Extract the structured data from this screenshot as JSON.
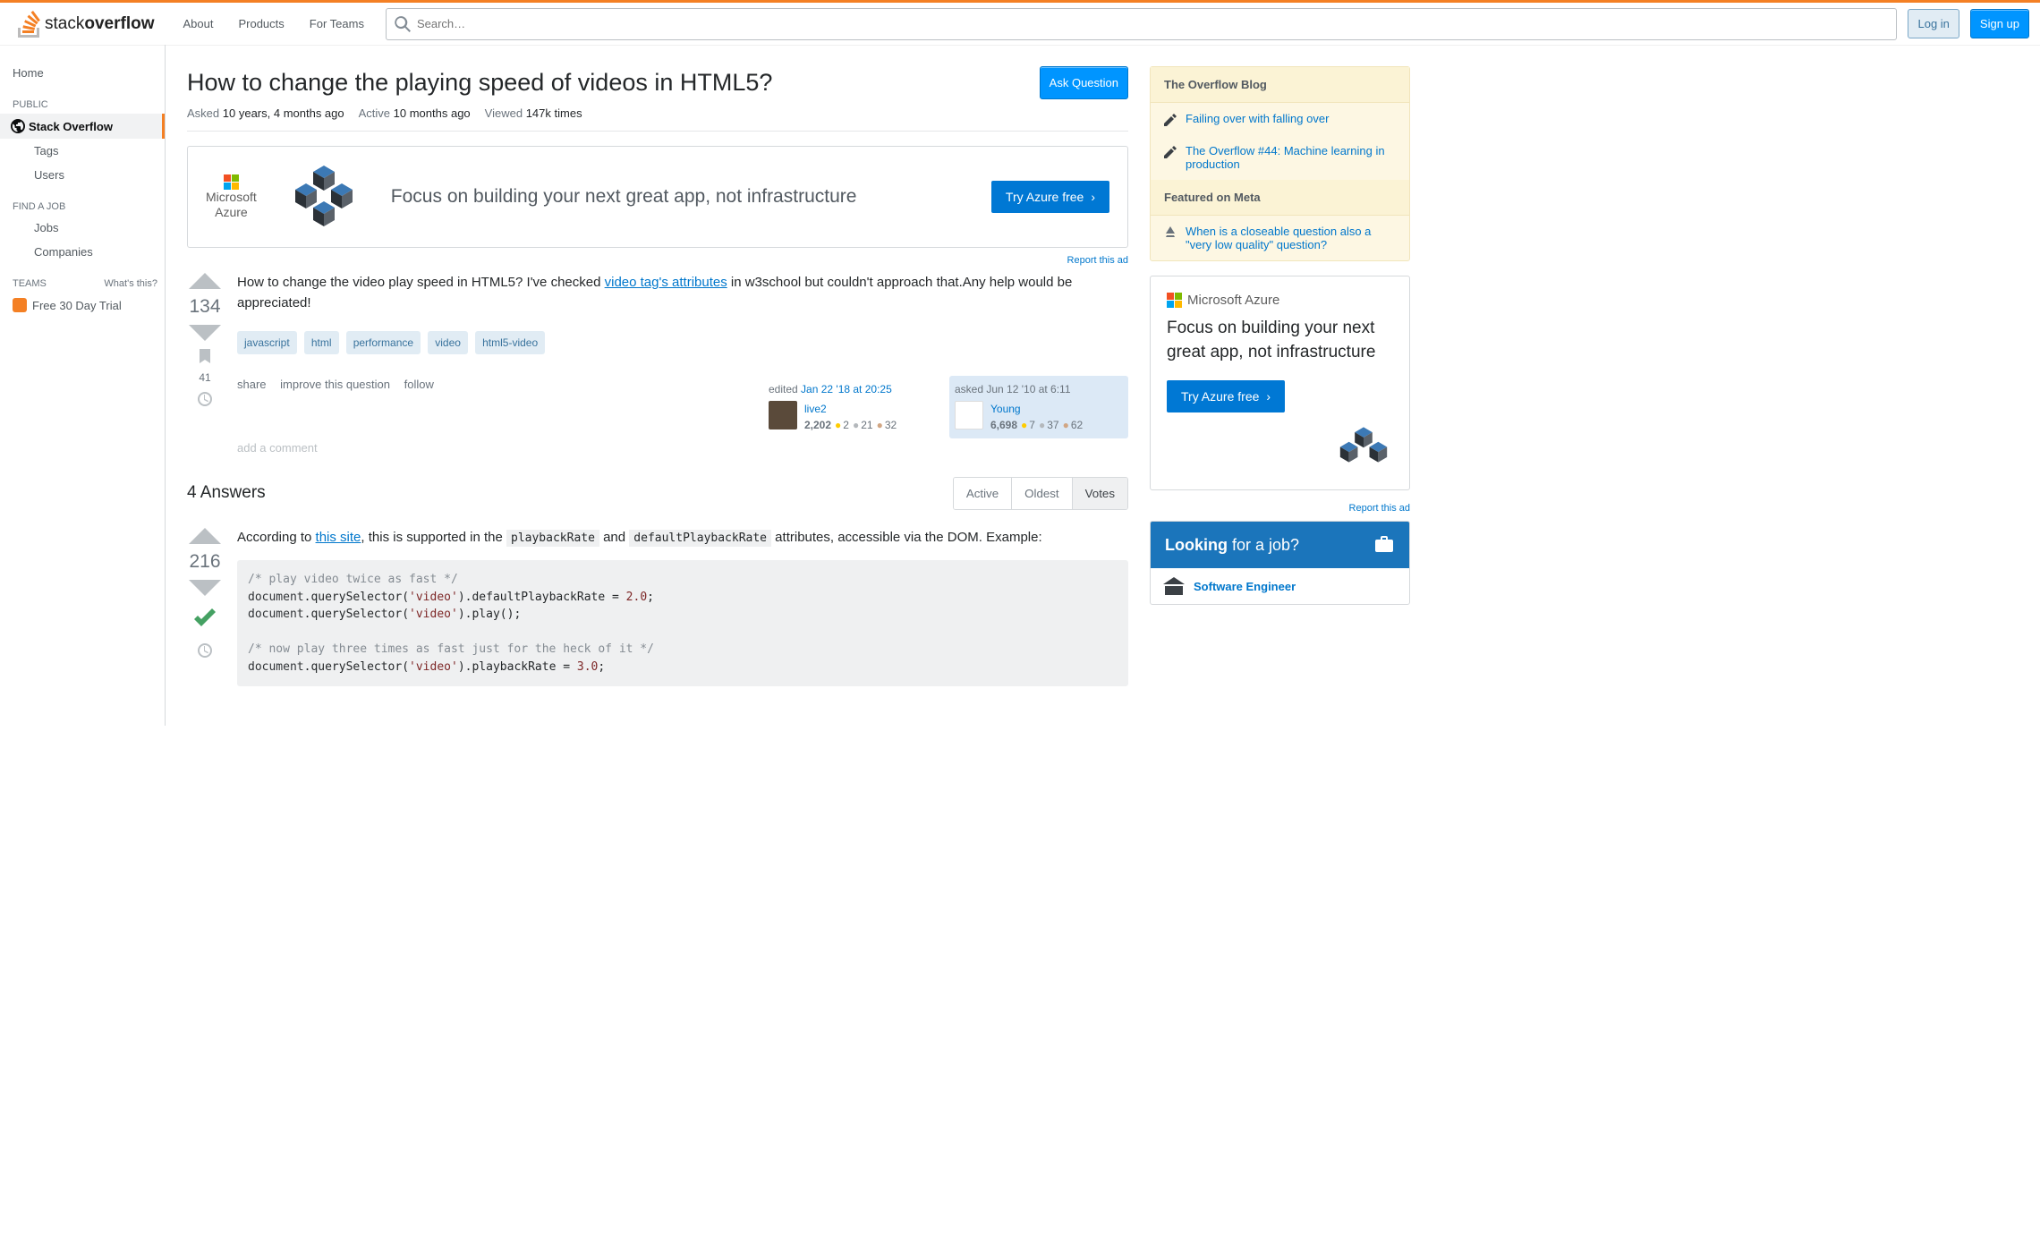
{
  "topbar": {
    "site_name_light": "stack",
    "site_name_bold": "overflow",
    "nav": {
      "about": "About",
      "products": "Products",
      "teams": "For Teams"
    },
    "search_placeholder": "Search…",
    "login": "Log in",
    "signup": "Sign up"
  },
  "sidebar": {
    "home": "Home",
    "public": "PUBLIC",
    "so": "Stack Overflow",
    "tags": "Tags",
    "users": "Users",
    "findjob": "FIND A JOB",
    "jobs": "Jobs",
    "companies": "Companies",
    "teams": "TEAMS",
    "whats": "What's this?",
    "trial": "Free 30 Day Trial"
  },
  "question": {
    "title": "How to change the playing speed of videos in HTML5?",
    "ask_btn": "Ask Question",
    "asked_lbl": "Asked",
    "asked_val": "10 years, 4 months ago",
    "active_lbl": "Active",
    "active_val": "10 months ago",
    "viewed_lbl": "Viewed",
    "viewed_val": "147k times",
    "body_a": "How to change the video play speed in HTML5? I've checked ",
    "body_link": "video tag's attributes",
    "body_b": " in w3school but couldn't approach that.Any help would be appreciated!",
    "score": "134",
    "tags": [
      "javascript",
      "html",
      "performance",
      "video",
      "html5-video"
    ],
    "share": "share",
    "improve": "improve this question",
    "follow": "follow",
    "bookmark_count": "41",
    "editor": {
      "prefix": "edited",
      "time": "Jan 22 '18 at 20:25",
      "name": "live2",
      "rep": "2,202",
      "gold": "2",
      "silver": "21",
      "bronze": "32"
    },
    "asker": {
      "prefix": "asked",
      "time": "Jun 12 '10 at 6:11",
      "name": "Young",
      "rep": "6,698",
      "gold": "7",
      "silver": "37",
      "bronze": "62"
    },
    "add_comment": "add a comment"
  },
  "answers": {
    "count_text": "4 Answers",
    "tabs": {
      "active": "Active",
      "oldest": "Oldest",
      "votes": "Votes"
    },
    "a1": {
      "score": "216",
      "line1a": "According to ",
      "line1link": "this site",
      "line1b": ", this is supported in the ",
      "code1": "playbackRate",
      "line1c": " and ",
      "code2": "defaultPlaybackRate",
      "line1d": " attributes, accessible via the DOM. Example:",
      "code_lines": [
        {
          "t": "cm",
          "v": "/* play video twice as fast */"
        },
        {
          "t": "l",
          "v": "document.querySelector('video').defaultPlaybackRate = 2.0;"
        },
        {
          "t": "l",
          "v": "document.querySelector('video').play();"
        },
        {
          "t": "blank",
          "v": ""
        },
        {
          "t": "cm",
          "v": "/* now play three times as fast just for the heck of it */"
        },
        {
          "t": "l",
          "v": "document.querySelector('video').playbackRate = 3.0;"
        }
      ]
    }
  },
  "banner": {
    "brand": "Microsoft Azure",
    "text": "Focus on building your next great app, not infrastructure",
    "cta": "Try Azure free",
    "report": "Report this ad"
  },
  "side": {
    "blog_head": "The Overflow Blog",
    "blog1": "Failing over with falling over",
    "blog2": "The Overflow #44: Machine learning in production",
    "meta_head": "Featured on Meta",
    "meta1": "When is a closeable question also a \"very low quality\" question?",
    "ad_brand": "Microsoft Azure",
    "ad_text": "Focus on building your next great app, not infrastructure",
    "ad_cta": "Try Azure free",
    "ad_report": "Report this ad",
    "job_head_a": "Looking",
    "job_head_b": " for a job?",
    "job1": "Software Engineer"
  }
}
